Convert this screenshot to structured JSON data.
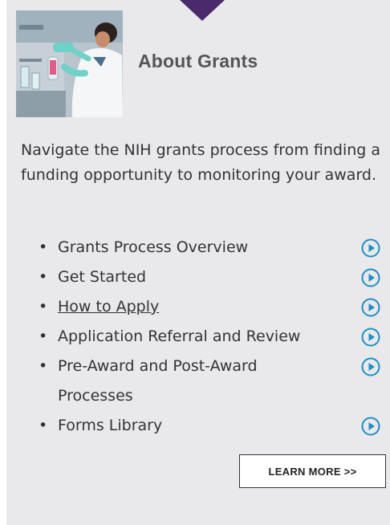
{
  "card": {
    "title": "About Grants",
    "description": "Navigate the NIH grants process from finding a funding opportunity to monitoring your award.",
    "accent_color": "#4b2a6b",
    "icon_color": "#1f8fc4",
    "items": [
      {
        "label": "Grants Process Overview",
        "underlined": false,
        "icon": "play-circle-icon"
      },
      {
        "label": "Get Started",
        "underlined": false,
        "icon": "play-circle-icon"
      },
      {
        "label": "How to Apply",
        "underlined": true,
        "icon": "play-circle-icon"
      },
      {
        "label": "Application Referral and Review",
        "underlined": false,
        "icon": "play-circle-icon"
      },
      {
        "label": "Pre-Award and Post-Award Processes",
        "underlined": false,
        "icon": "play-circle-icon"
      },
      {
        "label": "Forms Library",
        "underlined": false,
        "icon": "play-circle-icon"
      }
    ],
    "learn_more_label": "LEARN MORE >>"
  }
}
